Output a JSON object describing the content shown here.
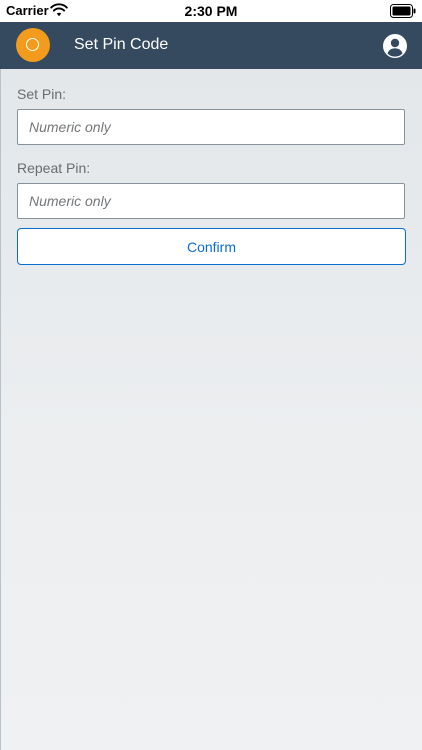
{
  "status_bar": {
    "carrier": "Carrier",
    "time": "2:30 PM",
    "wifi_icon": "wifi-icon",
    "battery_icon": "battery-icon"
  },
  "header": {
    "title": "Set Pin Code",
    "background_color": "#354a5f",
    "logo_icon": "app-logo-icon",
    "logo_color": "#f29b1d",
    "profile_icon": "user-circle-icon"
  },
  "form": {
    "set_pin": {
      "label": "Set Pin:",
      "placeholder": "Numeric only",
      "value": ""
    },
    "repeat_pin": {
      "label": "Repeat Pin:",
      "placeholder": "Numeric only",
      "value": ""
    },
    "confirm_label": "Confirm",
    "accent_color": "#0a6ed1"
  }
}
